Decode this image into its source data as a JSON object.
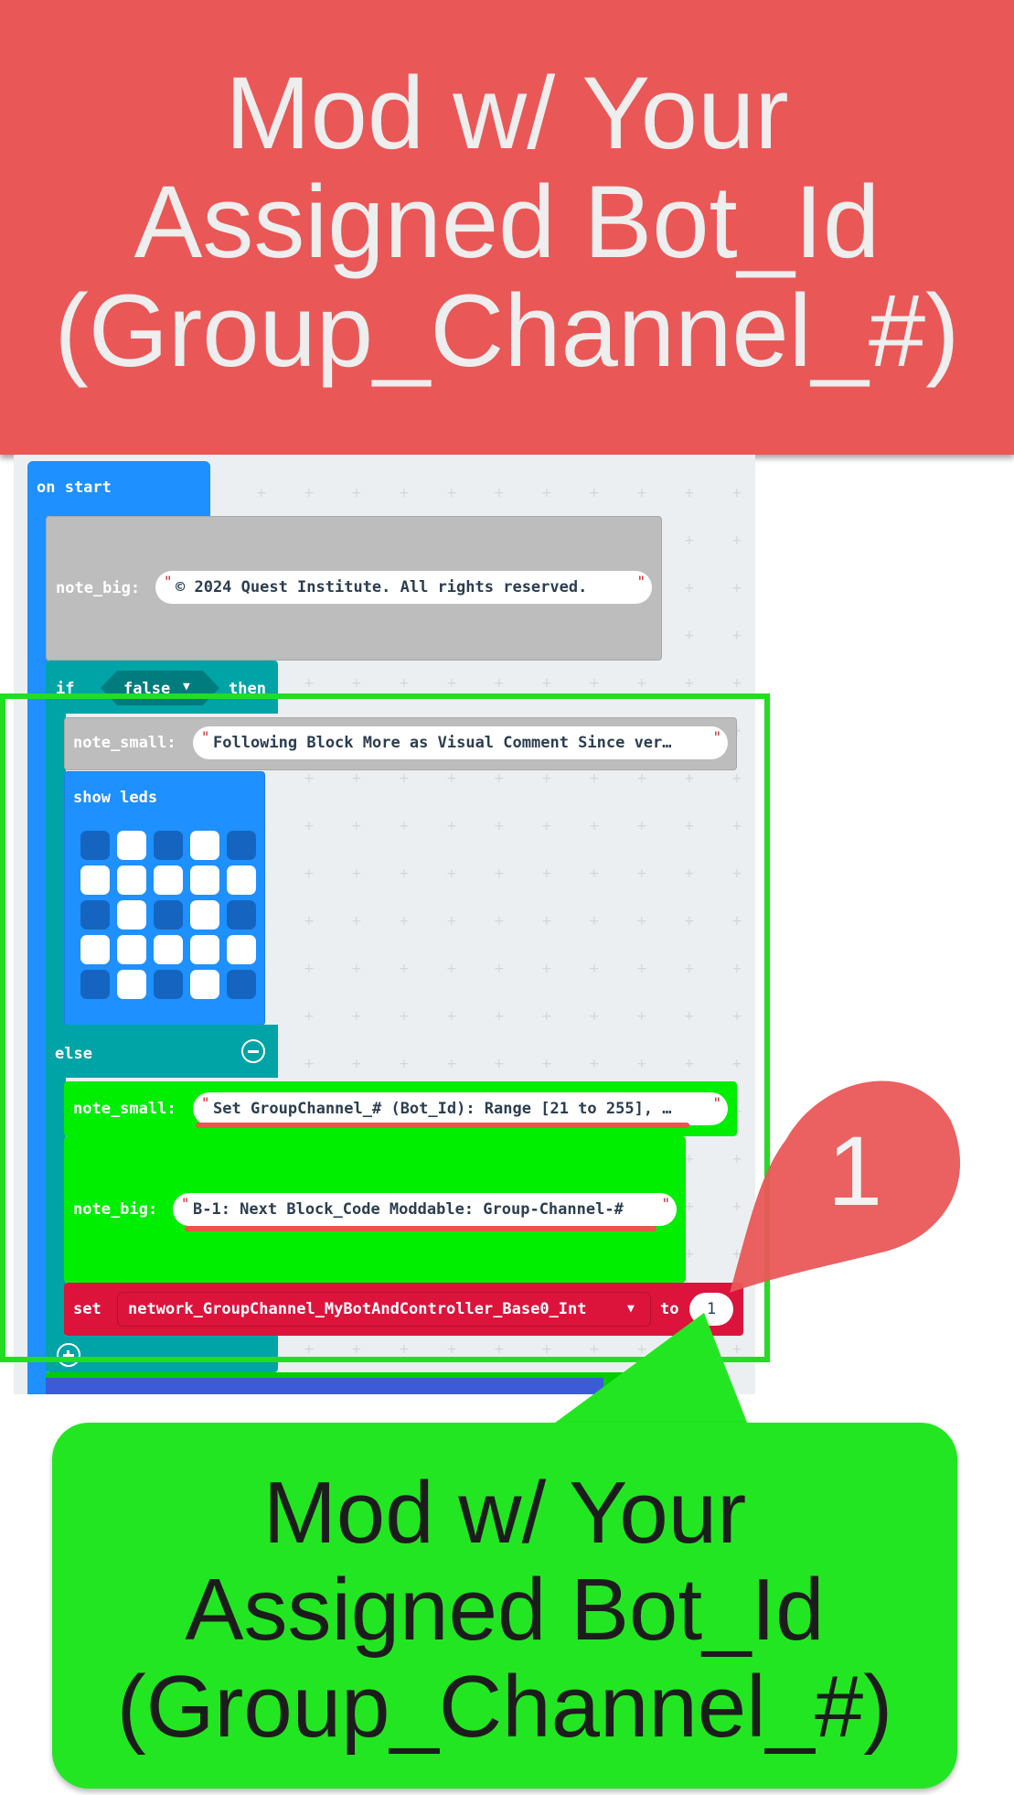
{
  "top_banner": {
    "line1": "Mod w/ Your",
    "line2": "Assigned Bot_Id",
    "line3": "(Group_Channel_#)"
  },
  "blocks": {
    "on_start": "on start",
    "note_big_1": {
      "label": "note_big:",
      "value": "© 2024 Quest Institute. All rights reserved."
    },
    "if_block": {
      "if": "if",
      "condition": "false",
      "then": "then"
    },
    "note_small_1": {
      "label": "note_small:",
      "value": "Following Block More as Visual Comment Since ver…"
    },
    "show_leds": {
      "label": "show leds",
      "grid": [
        [
          0,
          1,
          0,
          1,
          0
        ],
        [
          1,
          1,
          1,
          1,
          1
        ],
        [
          0,
          1,
          0,
          1,
          0
        ],
        [
          1,
          1,
          1,
          1,
          1
        ],
        [
          0,
          1,
          0,
          1,
          0
        ]
      ]
    },
    "else": "else",
    "note_small_2": {
      "label": "note_small:",
      "value": "Set GroupChannel_# (Bot_Id): Range [21 to 255], …"
    },
    "note_big_2": {
      "label": "note_big:",
      "value": "B-1: Next Block_Code Moddable: Group-Channel-#"
    },
    "set_block": {
      "set": "set",
      "variable": "network_GroupChannel_MyBotAndController_Base0_Int",
      "to": "to",
      "value": "1"
    }
  },
  "marker_badge": {
    "number": "1"
  },
  "bottom_callout": {
    "line1": "Mod w/ Your",
    "line2": "Assigned Bot_Id",
    "line3": "(Group_Channel_#)"
  },
  "colors": {
    "red_banner": "#ea5757",
    "green_callout": "#23e623",
    "highlight_box": "#22dd22",
    "block_blue": "#1e90ff",
    "block_teal": "#00a4a6",
    "block_gray": "#bdbdbd",
    "block_green": "#00ee00",
    "block_red": "#dc143c"
  }
}
